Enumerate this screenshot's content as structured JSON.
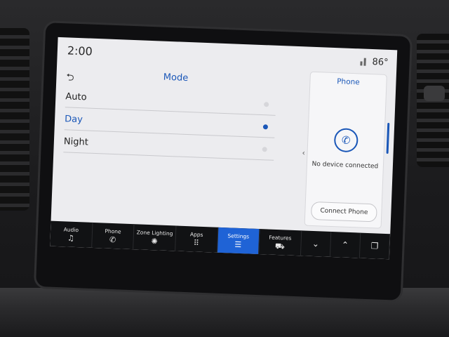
{
  "status": {
    "time": "2:00",
    "temperature": "86°"
  },
  "mode_panel": {
    "title": "Mode",
    "options": [
      {
        "label": "Auto",
        "selected": false
      },
      {
        "label": "Day",
        "selected": true
      },
      {
        "label": "Night",
        "selected": false
      }
    ]
  },
  "phone": {
    "title": "Phone",
    "status_text": "No device connected",
    "connect_label": "Connect Phone"
  },
  "navbar": {
    "items": [
      {
        "label": "Audio",
        "icon": "music-note-icon"
      },
      {
        "label": "Phone",
        "icon": "phone-icon"
      },
      {
        "label": "Zone Lighting",
        "icon": "lighting-icon"
      },
      {
        "label": "Apps",
        "icon": "apps-grid-icon"
      },
      {
        "label": "Settings",
        "icon": "settings-sliders-icon",
        "active": true
      },
      {
        "label": "Features",
        "icon": "truck-icon"
      }
    ]
  },
  "colors": {
    "accent": "#1a57b8",
    "active_tab": "#1f63d6"
  }
}
